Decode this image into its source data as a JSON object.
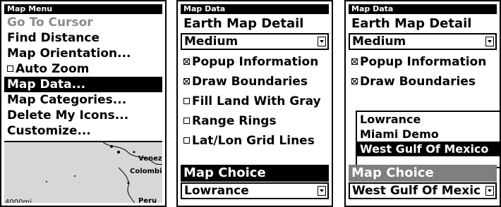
{
  "screen1": {
    "header": "Map Menu",
    "items": [
      {
        "label": "Go To Cursor"
      },
      {
        "label": "Find Distance"
      },
      {
        "label": "Map Orientation..."
      },
      {
        "label": "Auto Zoom"
      },
      {
        "label": "Map Data..."
      },
      {
        "label": "Map Categories..."
      },
      {
        "label": "Delete My Icons..."
      },
      {
        "label": "Customize..."
      }
    ],
    "map": {
      "labels": [
        "Venez",
        "Colombia",
        "Peru"
      ],
      "scale": "4000mi"
    }
  },
  "screen2": {
    "header": "Map Data",
    "detail_label": "Earth Map Detail",
    "detail_value": "Medium",
    "checkboxes": [
      {
        "label": "Popup Information",
        "checked": true
      },
      {
        "label": "Draw Boundaries",
        "checked": true
      },
      {
        "label": "Fill Land With Gray",
        "checked": false
      },
      {
        "label": "Range Rings",
        "checked": false
      },
      {
        "label": "Lat/Lon Grid Lines",
        "checked": false
      }
    ],
    "choice_label": "Map Choice",
    "choice_value": "Lowrance"
  },
  "screen3": {
    "header": "Map Data",
    "detail_label": "Earth Map Detail",
    "detail_value": "Medium",
    "checkboxes": [
      {
        "label": "Popup Information",
        "checked": true
      },
      {
        "label": "Draw Boundaries",
        "checked": true
      }
    ],
    "options": [
      "Lowrance",
      "Miami Demo",
      "West Gulf Of Mexico"
    ],
    "choice_label": "Map Choice",
    "choice_value": "West Gulf Of Mexic"
  }
}
